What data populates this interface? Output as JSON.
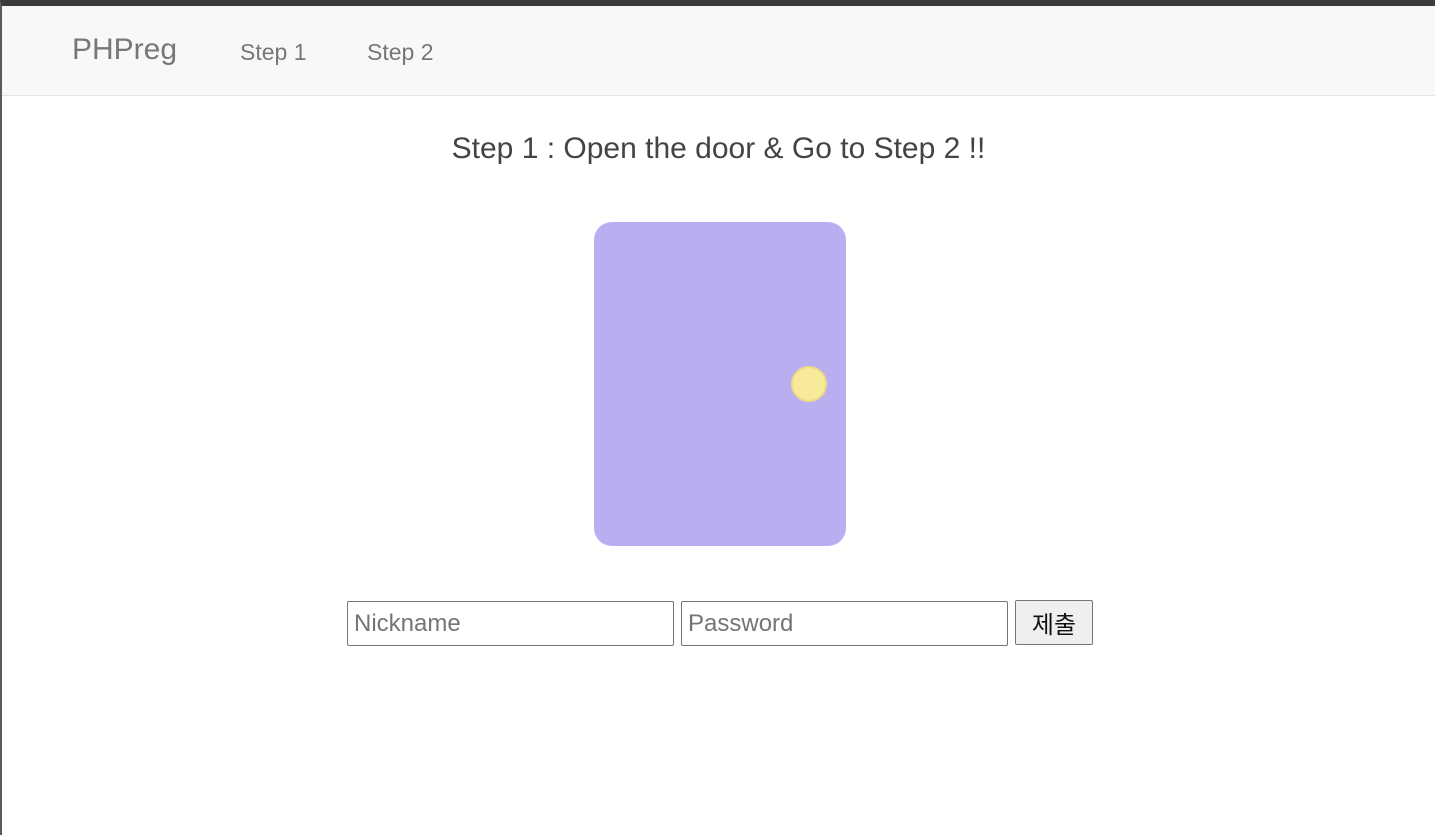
{
  "navbar": {
    "brand": "PHPreg",
    "links": [
      {
        "label": "Step 1"
      },
      {
        "label": "Step 2"
      }
    ]
  },
  "main": {
    "title": "Step 1 : Open the door & Go to Step 2 !!",
    "door": {
      "color": "#b8aef0",
      "knob_color": "#f7ea9a"
    },
    "form": {
      "nickname_placeholder": "Nickname",
      "nickname_value": "",
      "password_placeholder": "Password",
      "password_value": "",
      "submit_label": "제출"
    }
  }
}
